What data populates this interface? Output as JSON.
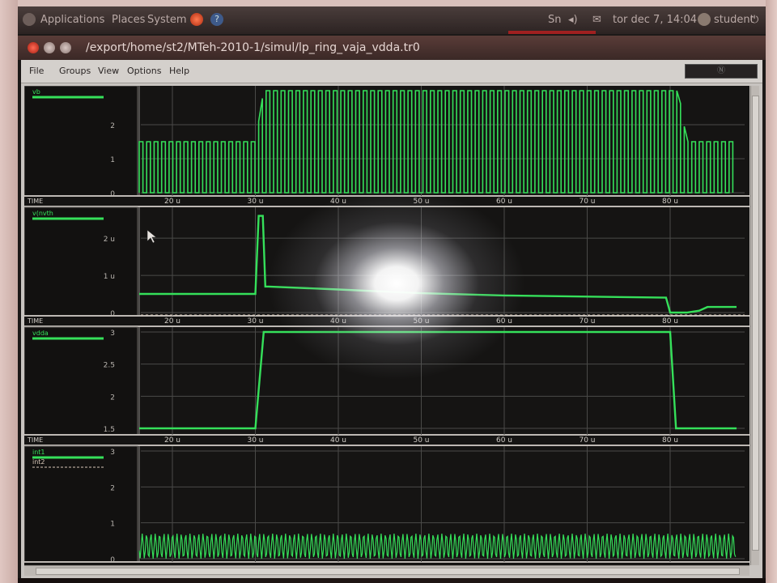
{
  "panel": {
    "applications": "Applications",
    "places": "Places",
    "system": "System",
    "keyboard": "Sn",
    "datetime": "tor dec  7, 14:04",
    "user": "student"
  },
  "window": {
    "title": "/export/home/st2/MTeh-2010-1/simul/lp_ring_vaja_vdda.tr0"
  },
  "menu": {
    "items": [
      "File",
      "Groups",
      "View",
      "Options",
      "Help"
    ],
    "right_button": "Ⓝ"
  },
  "colors": {
    "trace": "#35e05a",
    "grid": "#4a4a48",
    "plot_bg": "#151413",
    "dashed_trace": "#d8c8b8"
  },
  "axis": {
    "label": "TIME",
    "ticks": [
      "20 u",
      "30 u",
      "40 u",
      "50 u",
      "60 u",
      "70 u",
      "80 u"
    ]
  },
  "panels": [
    {
      "name": "vb",
      "legend": [
        "vb"
      ],
      "y_ticks": [
        "2",
        "1",
        "0"
      ]
    },
    {
      "name": "v(nvth",
      "legend": [
        "v(nvth"
      ],
      "y_ticks": [
        "2 u",
        "1 u",
        "0"
      ]
    },
    {
      "name": "vdda",
      "legend": [
        "vdda"
      ],
      "y_ticks": [
        "3",
        "2.5",
        "2",
        "1.5"
      ]
    },
    {
      "name": "int1",
      "legend": [
        "int1",
        "int2"
      ],
      "y_ticks": [
        "3",
        "2",
        "1",
        "0"
      ]
    }
  ],
  "chart_data": [
    {
      "type": "line",
      "title": "",
      "xlabel": "TIME",
      "series": [
        {
          "name": "vb",
          "x": [
            16,
            30,
            31,
            81,
            82,
            88
          ],
          "y": [
            1.5,
            1.5,
            3.0,
            3.0,
            1.5,
            1.5
          ]
        }
      ],
      "note_pulsed": true,
      "ylim": [
        0,
        3
      ]
    },
    {
      "type": "line",
      "xlabel": "TIME",
      "series": [
        {
          "name": "v(nvth",
          "x": [
            16,
            30,
            30.4,
            30.9,
            31.2,
            31.6,
            40,
            50,
            60,
            79.5,
            80,
            82,
            83.5,
            84.5,
            88
          ],
          "y": [
            0.5,
            0.5,
            2.6,
            2.6,
            0.7,
            0.7,
            0.62,
            0.52,
            0.46,
            0.4,
            0.0,
            0.0,
            0.05,
            0.15,
            0.15
          ]
        }
      ],
      "ylim": [
        0,
        2.7
      ]
    },
    {
      "type": "line",
      "xlabel": "TIME",
      "series": [
        {
          "name": "vdda",
          "x": [
            16,
            30,
            31,
            80,
            80.7,
            88
          ],
          "y": [
            1.5,
            1.5,
            3.0,
            3.0,
            1.5,
            1.5
          ]
        }
      ],
      "ylim": [
        1.45,
        3.0
      ]
    },
    {
      "type": "line",
      "xlabel": "TIME",
      "series": [
        {
          "name": "int1",
          "oscillating_between": [
            0,
            0.7
          ]
        },
        {
          "name": "int2"
        }
      ],
      "ylim": [
        0,
        3
      ]
    }
  ]
}
